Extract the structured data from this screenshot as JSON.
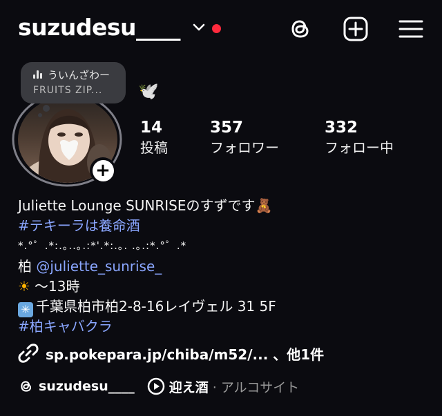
{
  "header": {
    "username": "suzudesu____",
    "notification_color": "#ff2a3d",
    "icons": [
      "threads-icon",
      "create-post-icon",
      "menu-icon"
    ]
  },
  "note": {
    "song": "ういんざわー",
    "artist": "FRUITS ZIP..."
  },
  "profile": {
    "emoji": "🕊️",
    "stats": [
      {
        "number": "14",
        "label": "投稿"
      },
      {
        "number": "357",
        "label": "フォロワー"
      },
      {
        "number": "332",
        "label": "フォロー中"
      }
    ]
  },
  "bio": {
    "line1": "Juliette Lounge SUNRISEのすずです🧸",
    "hashtag1": "#テキーラは養命酒",
    "sparkles": "*.°゜.*:.｡..｡.:*'.*:.｡. .｡.:*.°゜.*",
    "mention_prefix": "柏 ",
    "mention": "@juliette_sunrise_",
    "hours": "～13時",
    "address": "千葉県柏市柏2-8-16レイヴェル 31 5F",
    "hashtag2": "#柏キャバクラ"
  },
  "link": {
    "text": "sp.pokepara.jp/chiba/m52/... 、他1件"
  },
  "footer": {
    "threads_handle": "suzudesu____",
    "song_title": "迎え酒",
    "song_artist": "· アルコサイト"
  },
  "colors": {
    "background": "#0b0b10",
    "link": "#8aa6ff"
  }
}
